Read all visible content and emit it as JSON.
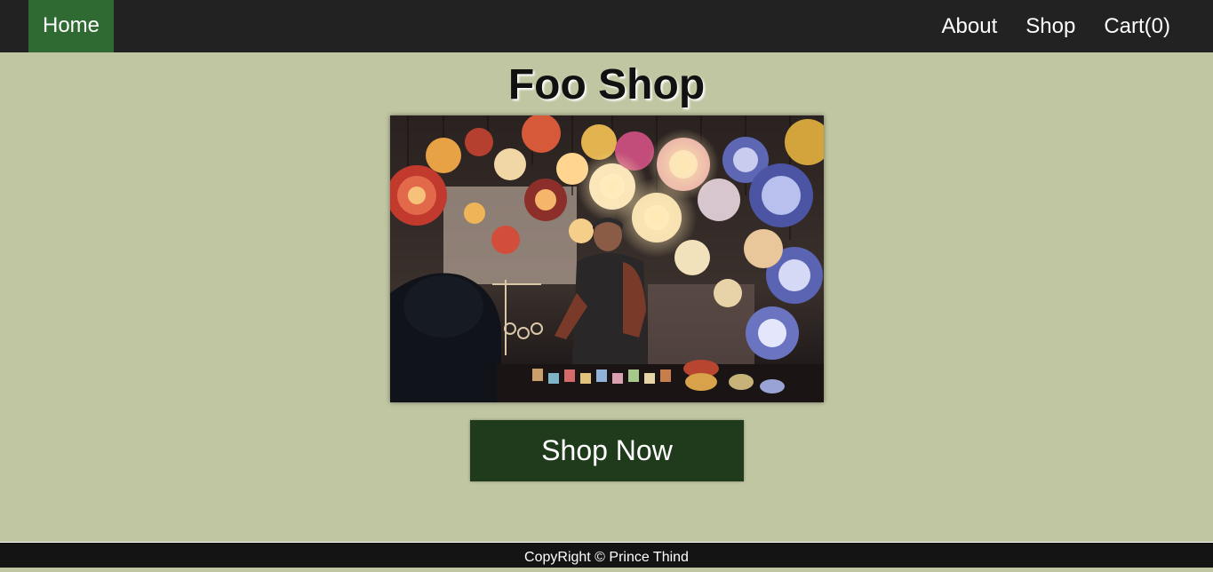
{
  "nav": {
    "home_label": "Home",
    "links": [
      {
        "label": "About"
      },
      {
        "label": "Shop"
      },
      {
        "label": "Cart(0)"
      }
    ]
  },
  "main": {
    "title": "Foo Shop",
    "cta_label": "Shop Now"
  },
  "footer": {
    "text": "CopyRight © Prince Thind"
  },
  "colors": {
    "nav_bg": "#222222",
    "nav_active": "#2f6a33",
    "page_bg": "#c0c6a2",
    "cta_bg": "#203b1b",
    "footer_bg": "#141414"
  }
}
